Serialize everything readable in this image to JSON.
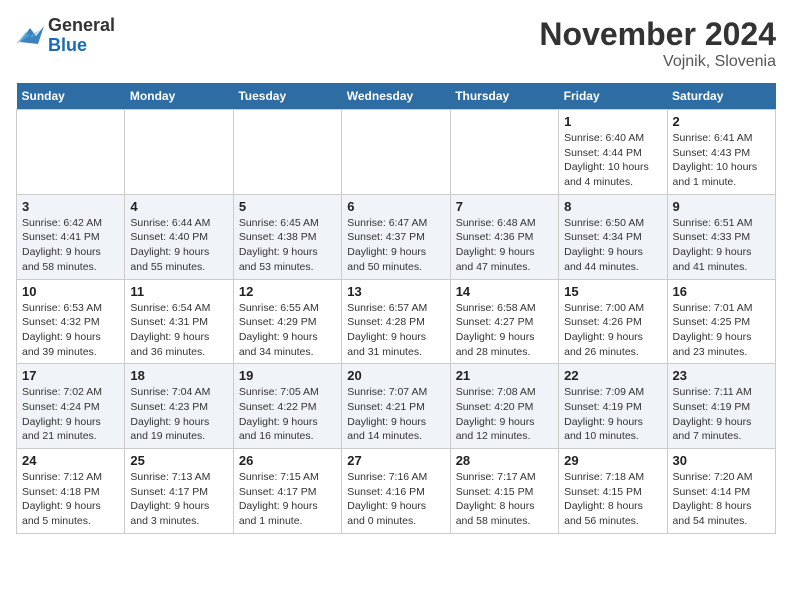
{
  "header": {
    "logo_general": "General",
    "logo_blue": "Blue",
    "title": "November 2024",
    "subtitle": "Vojnik, Slovenia"
  },
  "days": [
    "Sunday",
    "Monday",
    "Tuesday",
    "Wednesday",
    "Thursday",
    "Friday",
    "Saturday"
  ],
  "weeks": [
    [
      {
        "day": "",
        "sunrise": "",
        "sunset": "",
        "daylight": ""
      },
      {
        "day": "",
        "sunrise": "",
        "sunset": "",
        "daylight": ""
      },
      {
        "day": "",
        "sunrise": "",
        "sunset": "",
        "daylight": ""
      },
      {
        "day": "",
        "sunrise": "",
        "sunset": "",
        "daylight": ""
      },
      {
        "day": "",
        "sunrise": "",
        "sunset": "",
        "daylight": ""
      },
      {
        "day": "1",
        "sunrise": "Sunrise: 6:40 AM",
        "sunset": "Sunset: 4:44 PM",
        "daylight": "Daylight: 10 hours and 4 minutes."
      },
      {
        "day": "2",
        "sunrise": "Sunrise: 6:41 AM",
        "sunset": "Sunset: 4:43 PM",
        "daylight": "Daylight: 10 hours and 1 minute."
      }
    ],
    [
      {
        "day": "3",
        "sunrise": "Sunrise: 6:42 AM",
        "sunset": "Sunset: 4:41 PM",
        "daylight": "Daylight: 9 hours and 58 minutes."
      },
      {
        "day": "4",
        "sunrise": "Sunrise: 6:44 AM",
        "sunset": "Sunset: 4:40 PM",
        "daylight": "Daylight: 9 hours and 55 minutes."
      },
      {
        "day": "5",
        "sunrise": "Sunrise: 6:45 AM",
        "sunset": "Sunset: 4:38 PM",
        "daylight": "Daylight: 9 hours and 53 minutes."
      },
      {
        "day": "6",
        "sunrise": "Sunrise: 6:47 AM",
        "sunset": "Sunset: 4:37 PM",
        "daylight": "Daylight: 9 hours and 50 minutes."
      },
      {
        "day": "7",
        "sunrise": "Sunrise: 6:48 AM",
        "sunset": "Sunset: 4:36 PM",
        "daylight": "Daylight: 9 hours and 47 minutes."
      },
      {
        "day": "8",
        "sunrise": "Sunrise: 6:50 AM",
        "sunset": "Sunset: 4:34 PM",
        "daylight": "Daylight: 9 hours and 44 minutes."
      },
      {
        "day": "9",
        "sunrise": "Sunrise: 6:51 AM",
        "sunset": "Sunset: 4:33 PM",
        "daylight": "Daylight: 9 hours and 41 minutes."
      }
    ],
    [
      {
        "day": "10",
        "sunrise": "Sunrise: 6:53 AM",
        "sunset": "Sunset: 4:32 PM",
        "daylight": "Daylight: 9 hours and 39 minutes."
      },
      {
        "day": "11",
        "sunrise": "Sunrise: 6:54 AM",
        "sunset": "Sunset: 4:31 PM",
        "daylight": "Daylight: 9 hours and 36 minutes."
      },
      {
        "day": "12",
        "sunrise": "Sunrise: 6:55 AM",
        "sunset": "Sunset: 4:29 PM",
        "daylight": "Daylight: 9 hours and 34 minutes."
      },
      {
        "day": "13",
        "sunrise": "Sunrise: 6:57 AM",
        "sunset": "Sunset: 4:28 PM",
        "daylight": "Daylight: 9 hours and 31 minutes."
      },
      {
        "day": "14",
        "sunrise": "Sunrise: 6:58 AM",
        "sunset": "Sunset: 4:27 PM",
        "daylight": "Daylight: 9 hours and 28 minutes."
      },
      {
        "day": "15",
        "sunrise": "Sunrise: 7:00 AM",
        "sunset": "Sunset: 4:26 PM",
        "daylight": "Daylight: 9 hours and 26 minutes."
      },
      {
        "day": "16",
        "sunrise": "Sunrise: 7:01 AM",
        "sunset": "Sunset: 4:25 PM",
        "daylight": "Daylight: 9 hours and 23 minutes."
      }
    ],
    [
      {
        "day": "17",
        "sunrise": "Sunrise: 7:02 AM",
        "sunset": "Sunset: 4:24 PM",
        "daylight": "Daylight: 9 hours and 21 minutes."
      },
      {
        "day": "18",
        "sunrise": "Sunrise: 7:04 AM",
        "sunset": "Sunset: 4:23 PM",
        "daylight": "Daylight: 9 hours and 19 minutes."
      },
      {
        "day": "19",
        "sunrise": "Sunrise: 7:05 AM",
        "sunset": "Sunset: 4:22 PM",
        "daylight": "Daylight: 9 hours and 16 minutes."
      },
      {
        "day": "20",
        "sunrise": "Sunrise: 7:07 AM",
        "sunset": "Sunset: 4:21 PM",
        "daylight": "Daylight: 9 hours and 14 minutes."
      },
      {
        "day": "21",
        "sunrise": "Sunrise: 7:08 AM",
        "sunset": "Sunset: 4:20 PM",
        "daylight": "Daylight: 9 hours and 12 minutes."
      },
      {
        "day": "22",
        "sunrise": "Sunrise: 7:09 AM",
        "sunset": "Sunset: 4:19 PM",
        "daylight": "Daylight: 9 hours and 10 minutes."
      },
      {
        "day": "23",
        "sunrise": "Sunrise: 7:11 AM",
        "sunset": "Sunset: 4:19 PM",
        "daylight": "Daylight: 9 hours and 7 minutes."
      }
    ],
    [
      {
        "day": "24",
        "sunrise": "Sunrise: 7:12 AM",
        "sunset": "Sunset: 4:18 PM",
        "daylight": "Daylight: 9 hours and 5 minutes."
      },
      {
        "day": "25",
        "sunrise": "Sunrise: 7:13 AM",
        "sunset": "Sunset: 4:17 PM",
        "daylight": "Daylight: 9 hours and 3 minutes."
      },
      {
        "day": "26",
        "sunrise": "Sunrise: 7:15 AM",
        "sunset": "Sunset: 4:17 PM",
        "daylight": "Daylight: 9 hours and 1 minute."
      },
      {
        "day": "27",
        "sunrise": "Sunrise: 7:16 AM",
        "sunset": "Sunset: 4:16 PM",
        "daylight": "Daylight: 9 hours and 0 minutes."
      },
      {
        "day": "28",
        "sunrise": "Sunrise: 7:17 AM",
        "sunset": "Sunset: 4:15 PM",
        "daylight": "Daylight: 8 hours and 58 minutes."
      },
      {
        "day": "29",
        "sunrise": "Sunrise: 7:18 AM",
        "sunset": "Sunset: 4:15 PM",
        "daylight": "Daylight: 8 hours and 56 minutes."
      },
      {
        "day": "30",
        "sunrise": "Sunrise: 7:20 AM",
        "sunset": "Sunset: 4:14 PM",
        "daylight": "Daylight: 8 hours and 54 minutes."
      }
    ]
  ]
}
